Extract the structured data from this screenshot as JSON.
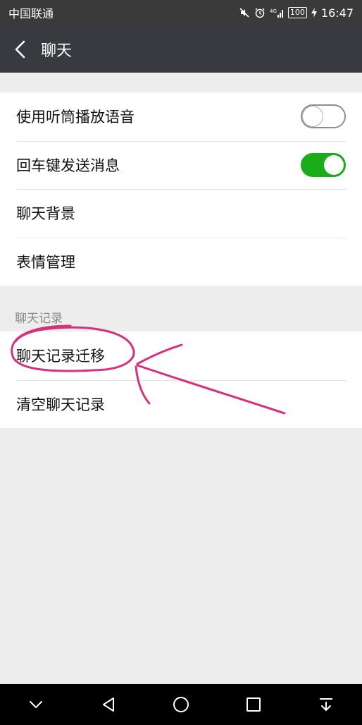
{
  "status_bar": {
    "carrier": "中国联通",
    "battery": "100",
    "time": "16:47",
    "icons": [
      "mute-icon",
      "alarm-icon",
      "signal-4g-icon",
      "battery-icon",
      "charging-icon"
    ]
  },
  "header": {
    "back_icon": "back-arrow-icon",
    "title": "聊天"
  },
  "settings": {
    "items": [
      {
        "label": "使用听筒播放语音",
        "control": "toggle",
        "on": false
      },
      {
        "label": "回车键发送消息",
        "control": "toggle",
        "on": true
      },
      {
        "label": "聊天背景",
        "control": "none"
      },
      {
        "label": "表情管理",
        "control": "none"
      }
    ]
  },
  "chat_history": {
    "header": "聊天记录",
    "items": [
      {
        "label": "聊天记录迁移"
      },
      {
        "label": "清空聊天记录"
      }
    ]
  },
  "annotation": {
    "color": "#d6317a",
    "description_shape": "hand-drawn circle and arrow"
  },
  "nav_bar": {
    "icons": [
      "collapse-icon",
      "back-triangle-icon",
      "home-circle-icon",
      "recent-square-icon",
      "notification-pull-icon"
    ]
  },
  "colors": {
    "toggle_on": "#1aad19",
    "title_bar": "#393a3f",
    "status_bar": "#3a3a3a",
    "background": "#ededed"
  }
}
